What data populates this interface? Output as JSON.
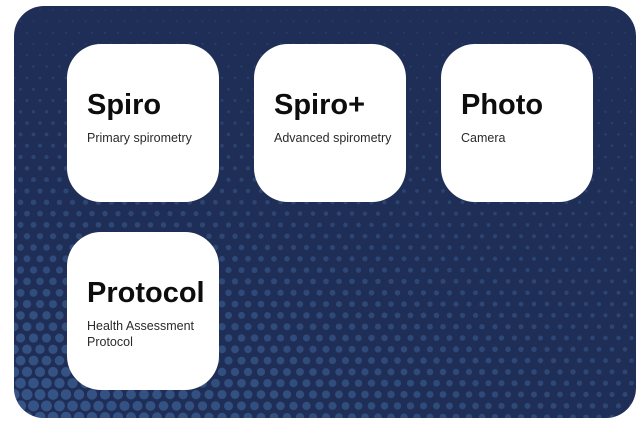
{
  "tiles": [
    {
      "title": "Spiro",
      "subtitle": "Primary spirometry"
    },
    {
      "title": "Spiro+",
      "subtitle": "Advanced spirometry"
    },
    {
      "title": "Photo",
      "subtitle": "Camera"
    },
    {
      "title": "Protocol",
      "subtitle": "Health Assessment Protocol"
    }
  ],
  "colors": {
    "panel_background": "#1f2e57",
    "dot_color": "#3b5f92",
    "tile_background": "#ffffff",
    "title_text": "#0d0d0d"
  }
}
